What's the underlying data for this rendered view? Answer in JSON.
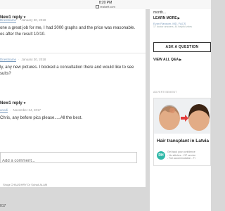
{
  "status_bar": {
    "time": "8:20 PM",
    "url": "realself.com"
  },
  "thread": {
    "reply_toggle_1": "New1 reply",
    "reply_1": {
      "author": "Dnestname",
      "date": "January 30, 2018",
      "lines": [
        "one a great job for me, I had 3000 graphs and the price was reasonable.",
        "os after the result 10/10."
      ]
    },
    "reply_2": {
      "author": "Dnestname",
      "date": "January 30, 2018",
      "lines": [
        "ly, any new pictures. I booked a consultation there and would like to see",
        "sults?"
      ]
    },
    "reply_toggle_2": "New1 reply",
    "reply_3": {
      "author": "anodi",
      "date": "November 24, 2017",
      "lines": [
        "Chris, any before pics please.....All the best."
      ]
    },
    "comment_placeholder": "Add a comment...",
    "footer": "Shuja CHAUDHRY  Dr Suhail ALAM",
    "year": "017"
  },
  "sidebar": {
    "snippet": "month...",
    "learn_more": "LEARN MORE",
    "doctor": "Evan Ransom, MD, FACS",
    "stats": "17 doctor answers, 44 helpful votes",
    "ask_button": "ASK A QUESTION",
    "view_all": "VIEW ALL Q&A",
    "advertisement": "ADVERTISEMENT",
    "ad": {
      "title": "Hair transplant in Latvia",
      "logo": "RH",
      "desc_lines": [
        "Get back your confidence",
        "- No stitches - VIP service",
        "- Full accommodation - Fr"
      ]
    }
  },
  "colors": {
    "accent_teal": "#2fb8a8",
    "link": "#7a9bbd",
    "background": "#d8d8d8"
  }
}
